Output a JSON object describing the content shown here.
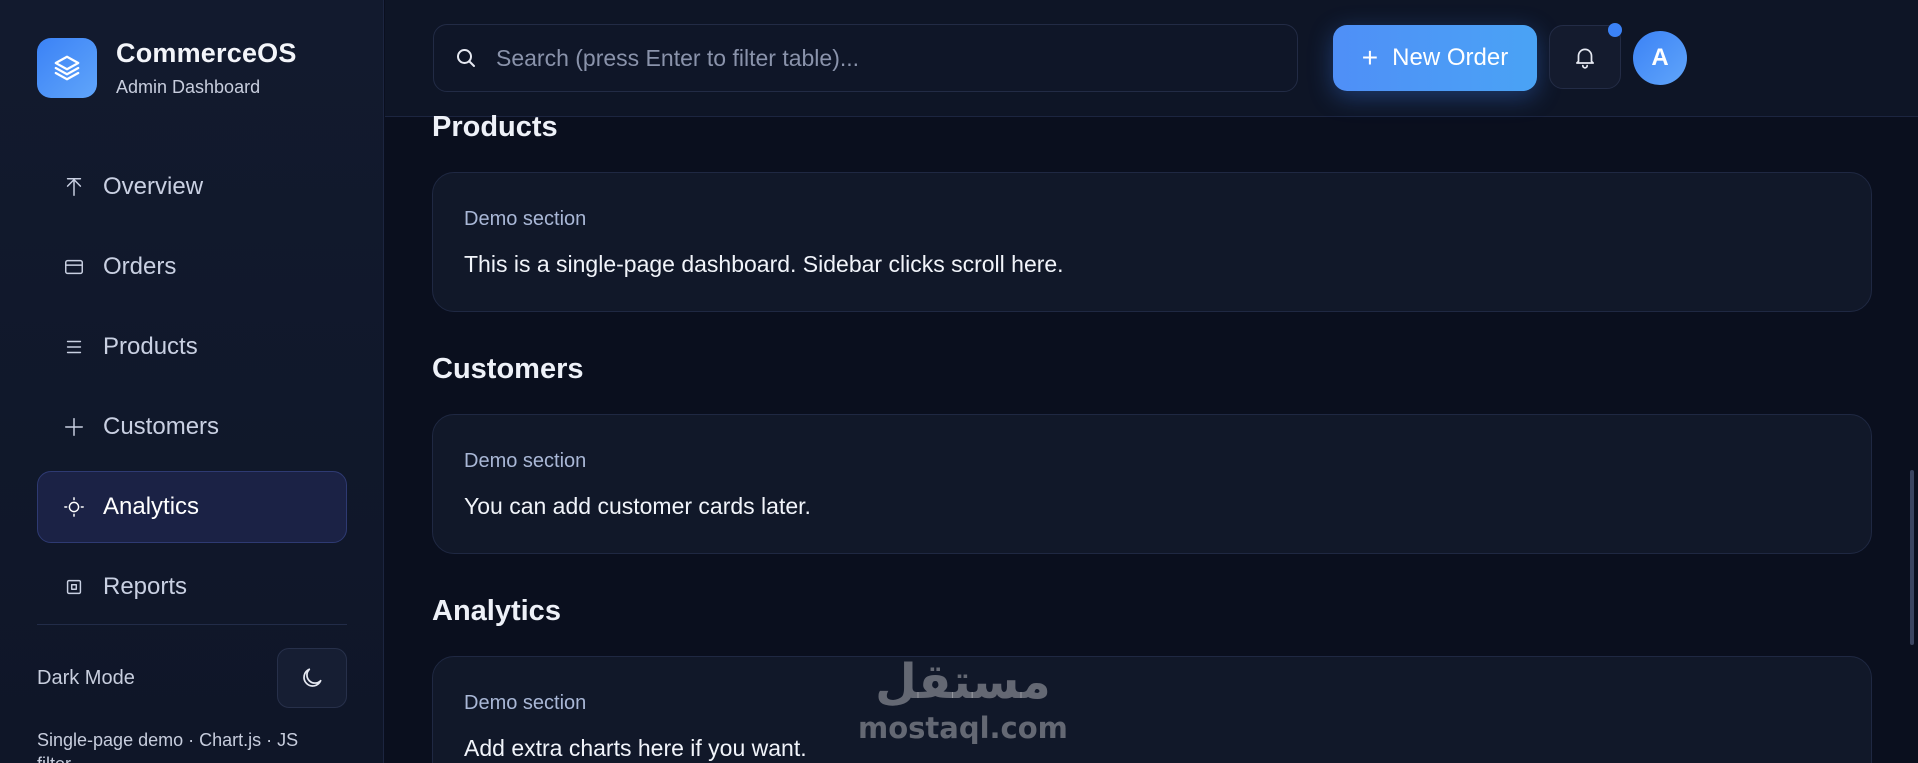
{
  "brand": {
    "name": "CommerceOS",
    "subtitle": "Admin Dashboard",
    "icon": "layers-icon"
  },
  "sidebar": {
    "items": [
      {
        "label": "Overview",
        "icon": "arrow-up-icon",
        "active": false
      },
      {
        "label": "Orders",
        "icon": "card-icon",
        "active": false
      },
      {
        "label": "Products",
        "icon": "list-icon",
        "active": false
      },
      {
        "label": "Customers",
        "icon": "plus-icon",
        "active": false
      },
      {
        "label": "Analytics",
        "icon": "sun-icon",
        "active": true
      },
      {
        "label": "Reports",
        "icon": "report-icon",
        "active": false
      }
    ],
    "dark_mode_label": "Dark Mode",
    "footer": "Single-page demo · Chart.js · JS filter"
  },
  "search": {
    "placeholder": "Search (press Enter to filter table)...",
    "value": ""
  },
  "topbar": {
    "new_order_label": "New Order",
    "avatar_initial": "A"
  },
  "sections": [
    {
      "title": "Products",
      "sub": "Demo section",
      "body": "This is a single-page dashboard. Sidebar clicks scroll here."
    },
    {
      "title": "Customers",
      "sub": "Demo section",
      "body": "You can add customer cards later."
    },
    {
      "title": "Analytics",
      "sub": "Demo section",
      "body": "Add extra charts here if you want."
    }
  ],
  "watermark": {
    "arabic": "مستقل",
    "latin": "mostaql.com"
  },
  "colors": {
    "accent": "#3b82f6",
    "background": "#0a0f1e",
    "sidebar": "#121a2e",
    "card": "#111829",
    "active_nav": "#1b2245"
  }
}
